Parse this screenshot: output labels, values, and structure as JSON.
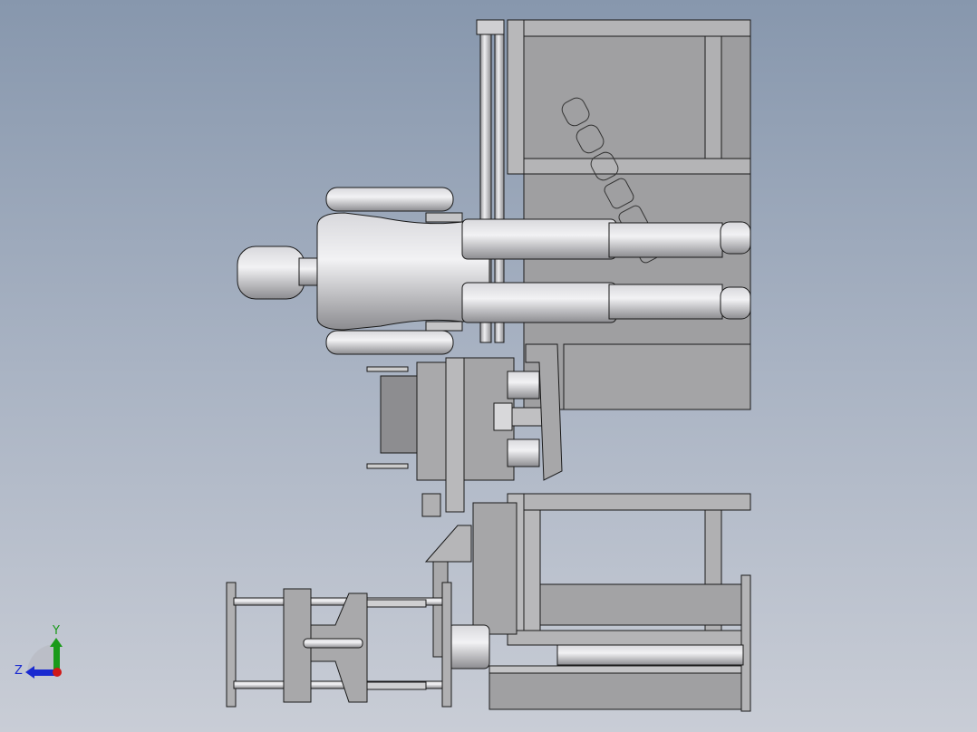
{
  "viewport": {
    "triad": {
      "y_label": "Y",
      "z_label": "Z",
      "y_color": "#1a9a1a",
      "z_color": "#1a2ad0",
      "x_color": "#d01818"
    },
    "colors": {
      "part_fill": "#a3a3a6",
      "part_light": "#e2e2e4",
      "edge": "#1a1a1a",
      "frame_fill": "#9d9d9f"
    }
  }
}
